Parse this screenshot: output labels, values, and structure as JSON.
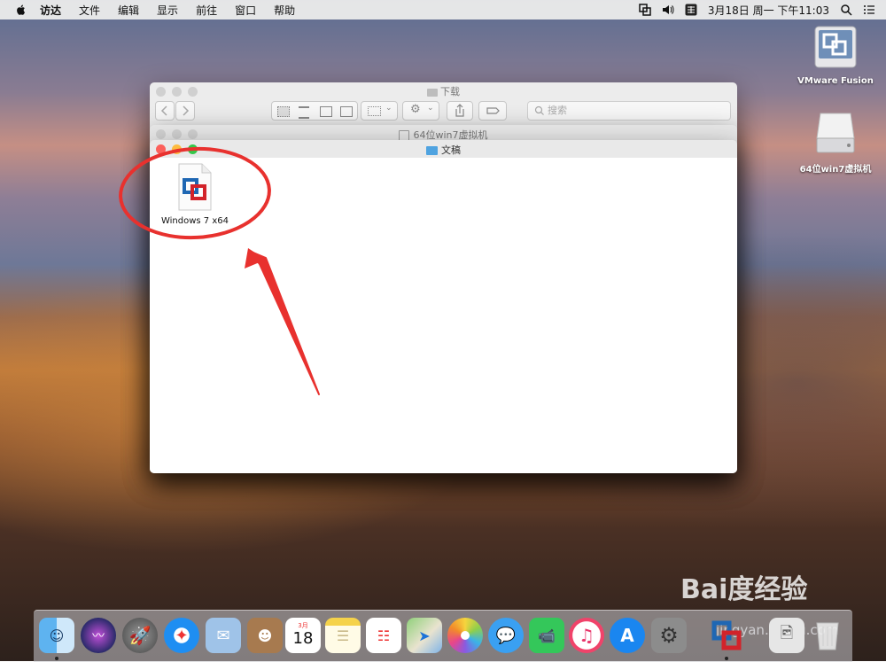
{
  "menubar": {
    "items": [
      "访达",
      "文件",
      "编辑",
      "显示",
      "前往",
      "窗口",
      "帮助"
    ],
    "clock": "3月18日 周一 下午11:03"
  },
  "desktop_icons": [
    {
      "label": "VMware Fusion",
      "icon": "vmware-fusion-icon"
    },
    {
      "label": "64位win7虚拟机",
      "icon": "disk-drive-icon"
    }
  ],
  "windows": {
    "back": {
      "title": "下载",
      "search_placeholder": "搜索"
    },
    "middle": {
      "title": "64位win7虚拟机"
    },
    "front": {
      "title": "文稿",
      "files": [
        {
          "name": "Windows 7 x64",
          "icon": "vmware-vm-document-icon"
        }
      ]
    }
  },
  "watermark": {
    "brand": "Bai度经验",
    "url": "jingyan.baidu.com"
  },
  "dock": {
    "apps": [
      "finder",
      "siri",
      "launchpad",
      "safari",
      "mail",
      "contacts",
      "calendar",
      "notes",
      "reminders",
      "maps",
      "photos",
      "messages",
      "facetime",
      "itunes",
      "app-store",
      "system-preferences",
      "vmware-fusion",
      "preview",
      "trash"
    ],
    "calendar_day": "18",
    "calendar_month": "3月"
  },
  "colors": {
    "close": "#fc605b",
    "minimize": "#fdbc40",
    "zoom": "#34c84a",
    "annotation": "#e8312e"
  }
}
